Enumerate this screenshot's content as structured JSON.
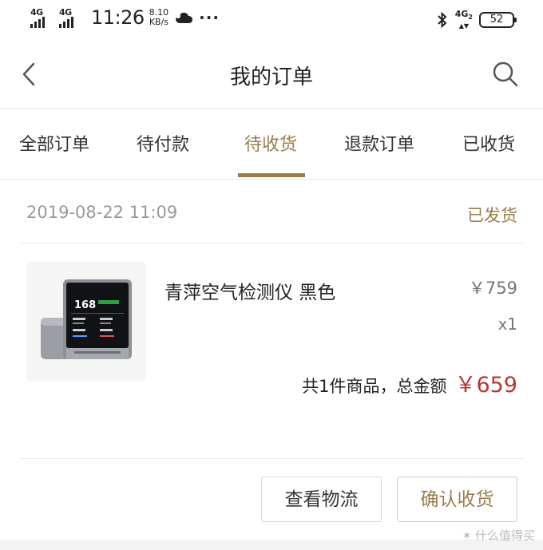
{
  "status_bar": {
    "signal1": "4G",
    "signal2": "4G",
    "time": "11:26",
    "speed_value": "8.10",
    "speed_unit": "KB/s",
    "more": "···",
    "network": "4G",
    "network_sub": "2",
    "battery": "52"
  },
  "nav": {
    "title": "我的订单"
  },
  "tabs": [
    {
      "label": "全部订单"
    },
    {
      "label": "待付款"
    },
    {
      "label": "待收货",
      "active": true
    },
    {
      "label": "退款订单"
    },
    {
      "label": "已收货"
    }
  ],
  "order": {
    "date": "2019-08-22 11:09",
    "status": "已发货",
    "product": {
      "name": "青萍空气检测仪 黑色",
      "price": "￥759",
      "qty": "x1",
      "screen_value": "168"
    },
    "summary_label": "共1件商品，总金额",
    "summary_amount": "￥659"
  },
  "actions": {
    "logistics": "查看物流",
    "confirm": "确认收货"
  },
  "watermark": "什么值得买",
  "colors": {
    "accent": "#9a7d4e",
    "price_red": "#b33a34"
  }
}
